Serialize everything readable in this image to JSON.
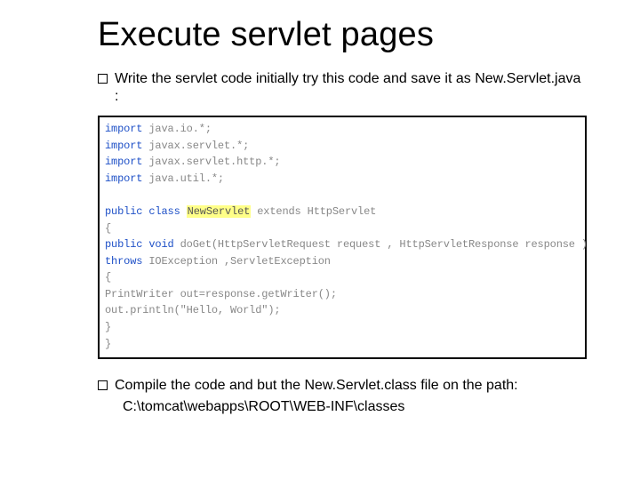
{
  "title": "Execute servlet pages",
  "bullets": {
    "b1": "Write the servlet code initially try this code and save it as New.Servlet.java :",
    "b2": "Compile the code and but the New.Servlet.class file on the path:",
    "b2_sub": "C:\\tomcat\\webapps\\ROOT\\WEB-INF\\classes"
  },
  "code": {
    "l1a": "import",
    "l1b": " java.io.*;",
    "l2a": "import",
    "l2b": " javax.servlet.*;",
    "l3a": "import",
    "l3b": " javax.servlet.http.*;",
    "l4a": "import",
    "l4b": " java.util.*;",
    "blank": "",
    "l5a": "public class ",
    "l5h": "NewServlet",
    "l5b": " extends HttpServlet",
    "l6": "{",
    "l7a": "public void",
    "l7b": " doGet(HttpServletRequest request , HttpServletResponse response )",
    "l8a": "throws",
    "l8b": " IOException ,ServletException",
    "l9": "{",
    "l10": "PrintWriter out=response.getWriter();",
    "l11": "out.println(\"Hello, World\");",
    "l12": "}",
    "l13": "}"
  }
}
